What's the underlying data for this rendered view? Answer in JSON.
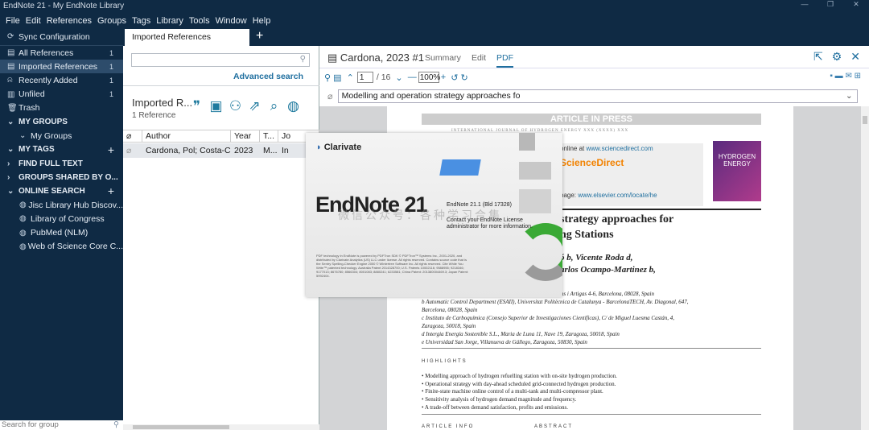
{
  "window": {
    "title": "EndNote 21 - My EndNote Library"
  },
  "menu": [
    "File",
    "Edit",
    "References",
    "Groups",
    "Tags",
    "Library",
    "Tools",
    "Window",
    "Help"
  ],
  "sidebar": {
    "sync": "Sync Configuration",
    "items": [
      {
        "label": "All References",
        "count": "1"
      },
      {
        "label": "Imported References",
        "count": "1"
      },
      {
        "label": "Recently Added",
        "count": "1"
      },
      {
        "label": "Unfiled",
        "count": "1"
      },
      {
        "label": "Trash",
        "count": ""
      }
    ],
    "my_groups": "MY GROUPS",
    "my_groups_sub": "My Groups",
    "my_tags": "MY TAGS",
    "find_full_text": "FIND FULL TEXT",
    "groups_shared": "GROUPS SHARED BY O...",
    "online_search": "ONLINE SEARCH",
    "online": [
      "Jisc Library Hub Discov...",
      "Library of Congress",
      "PubMed (NLM)",
      "Web of Science Core C..."
    ],
    "search_placeholder": "Search for group"
  },
  "tabs": {
    "active": "Imported References"
  },
  "list": {
    "advanced_search": "Advanced search",
    "group_title": "Imported R...",
    "ref_count": "1 Reference",
    "columns": [
      "Author",
      "Year",
      "T...",
      "Jo"
    ],
    "rows": [
      {
        "author": "Cardona, Pol; Costa-Ca...",
        "year": "2023",
        "title": "M...",
        "journal": "In"
      }
    ]
  },
  "reference": {
    "title": "Cardona, 2023 #1",
    "tabs": [
      "Summary",
      "Edit",
      "PDF"
    ],
    "page_current": "1",
    "page_total": "/ 16",
    "zoom": "100%",
    "attachment": "Modelling and operation strategy approaches fo"
  },
  "pdf": {
    "banner": "ARTICLE IN PRESS",
    "journal": "INTERNATIONAL JOURNAL OF HYDROGEN ENERGY XXX (XXXX) XXX",
    "online_at": "online at ",
    "online_link": "www.sciencedirect.com",
    "sd": "ScienceDirect",
    "homepage": "page: ",
    "homepage_link": "www.elsevier.com/locate/he",
    "cover": "HYDROGEN ENERGY",
    "title_l1": "strategy approaches for",
    "title_l2": "ng Stations",
    "auth_l1": "ó b, Vicente Roda d,",
    "auth_l2": "arlos Ocampo-Martinez b,",
    "aff": [
      "Llorens i Artigas 4-6, Barcelona, 08028, Spain",
      "b Automatic Control Department (ESAII), Universitat Politècnica de Catalunya - BarcelonaTECH, Av. Diagonal, 647,",
      "Barcelona, 08028, Spain",
      "c Instituto de Carboquímica (Consejo Superior de Investigaciones Científicas), C/ de Miguel Luesma Castán, 4,",
      "Zaragoza, 50018, Spain",
      "d Intergia Energía Sostenible S.L., Maria de Luna 11, Nave 19, Zaragoza, 50018, Spain",
      "e Universidad San Jorge, Villanueva de Gállego, Zaragoza, 50830, Spain"
    ],
    "highlights_title": "HIGHLIGHTS",
    "highlights": [
      "• Modelling approach of hydrogen refuelling station with on-site hydrogen production.",
      "• Operational strategy with day-ahead scheduled grid-connected hydrogen production.",
      "• Finite-state machine online control of a multi-tank and multi-compressor plant.",
      "• Sensitivity analysis of hydrogen demand magnitude and frequency.",
      "• A trade-off between demand satisfaction, profits and emissions."
    ],
    "article_info": "ARTICLE INFO",
    "abstract": "ABSTRACT"
  },
  "splash": {
    "brand": "Clarivate",
    "product": "EndNote 21",
    "version": "EndNote 21.1 (Bld 17328)",
    "contact": "Contact your EndNote License administrator for more information.",
    "fine": "PDF technology in EndNote is powered by PDFTron SDK © PDFTron™ Systems Inc., 2001-2020, and distributed by Clarivate Analytics (US) LLC under license. All rights reserved. Contains source code that is the Sentry Spelling-Checker Engine 2000 © Wintertree Software Inc. All rights reserved. Cite While You Write™ patented technology. Australia Patent 2014328700; U.S. Patents 10002116; 9588955; 9218346; 9177013; 8676780; 8566304; 8001083; 8880241; 6233581; China Patent: 201380004469.3; Japan Patent: 5992404."
  },
  "watermark": "微信公众号：各种学习合集"
}
